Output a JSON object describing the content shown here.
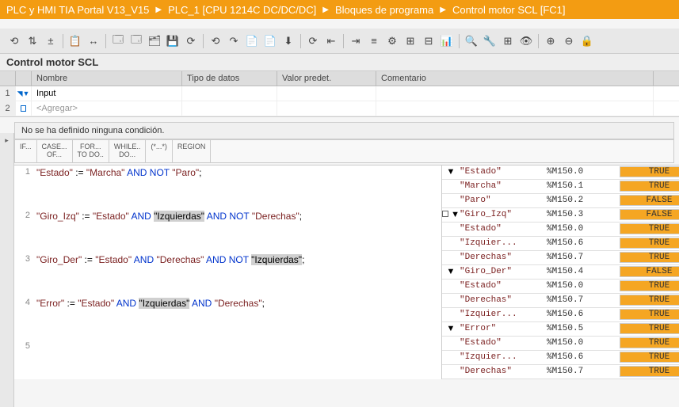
{
  "breadcrumb": {
    "project": "PLC y HMI TIA Portal V13_V15",
    "plc": "PLC_1 [CPU 1214C DC/DC/DC]",
    "folder": "Bloques de programa",
    "block": "Control motor SCL [FC1]"
  },
  "blockTitle": "Control motor SCL",
  "params": {
    "headers": {
      "name": "Nombre",
      "type": "Tipo de datos",
      "default": "Valor predet.",
      "comment": "Comentario"
    },
    "rows": [
      {
        "num": "1",
        "icon": "tri",
        "name": "Input"
      },
      {
        "num": "2",
        "icon": "sq",
        "name": "<Agregar>",
        "add": true
      }
    ]
  },
  "condText": "No se ha definido ninguna condición.",
  "snippets": [
    "IF...",
    "CASE...\nOF...",
    "FOR...\nTO DO..",
    "WHILE..\nDO...",
    "(*...*)",
    "REGION"
  ],
  "code": [
    {
      "n": "1",
      "seg": [
        [
          "str",
          "\"Estado\""
        ],
        [
          "t",
          " := "
        ],
        [
          "str",
          "\"Marcha\""
        ],
        [
          "t",
          " "
        ],
        [
          "kw",
          "AND NOT"
        ],
        [
          "t",
          " "
        ],
        [
          "str",
          "\"Paro\""
        ],
        [
          "t",
          ";"
        ]
      ]
    },
    {
      "blank": true
    },
    {
      "n": "2",
      "seg": [
        [
          "str",
          "\"Giro_Izq\""
        ],
        [
          "t",
          " := "
        ],
        [
          "str",
          "\"Estado\""
        ],
        [
          "t",
          " "
        ],
        [
          "kw",
          "AND"
        ],
        [
          "t",
          " "
        ],
        [
          "hl",
          "\"Izquierdas\""
        ],
        [
          "t",
          " "
        ],
        [
          "kw",
          "AND NOT"
        ],
        [
          "t",
          " "
        ],
        [
          "str",
          "\"Derechas\""
        ],
        [
          "t",
          ";"
        ]
      ]
    },
    {
      "blank": true
    },
    {
      "n": "3",
      "seg": [
        [
          "str",
          "\"Giro_Der\""
        ],
        [
          "t",
          " := "
        ],
        [
          "str",
          "\"Estado\""
        ],
        [
          "t",
          " "
        ],
        [
          "kw",
          "AND"
        ],
        [
          "t",
          " "
        ],
        [
          "str",
          "\"Derechas\""
        ],
        [
          "t",
          " "
        ],
        [
          "kw",
          "AND NOT"
        ],
        [
          "t",
          " "
        ],
        [
          "hl",
          "\"Izquierdas\""
        ],
        [
          "t",
          ";"
        ]
      ]
    },
    {
      "blank": true
    },
    {
      "n": "4",
      "seg": [
        [
          "str",
          "\"Error\""
        ],
        [
          "t",
          " := "
        ],
        [
          "str",
          "\"Estado\""
        ],
        [
          "t",
          " "
        ],
        [
          "kw",
          "AND"
        ],
        [
          "t",
          " "
        ],
        [
          "hl",
          "\"Izquierdas\""
        ],
        [
          "t",
          " "
        ],
        [
          "kw",
          "AND"
        ],
        [
          "t",
          " "
        ],
        [
          "str",
          "\"Derechas\""
        ],
        [
          "t",
          ";"
        ]
      ]
    },
    {
      "blank": true
    },
    {
      "n": "5",
      "seg": []
    }
  ],
  "watch": [
    {
      "g": 1,
      "arr": "▼",
      "nm": "\"Estado\"",
      "ad": "%M150.0",
      "vl": "TRUE"
    },
    {
      "g": 1,
      "nm": "\"Marcha\"",
      "ad": "%M150.1",
      "vl": "TRUE"
    },
    {
      "g": 1,
      "nm": "\"Paro\"",
      "ad": "%M150.2",
      "vl": "FALSE"
    },
    {
      "g": 2,
      "arr": "▼",
      "sq": true,
      "nm": "\"Giro_Izq\"",
      "ad": "%M150.3",
      "vl": "FALSE"
    },
    {
      "g": 2,
      "nm": "\"Estado\"",
      "ad": "%M150.0",
      "vl": "TRUE"
    },
    {
      "g": 2,
      "nm": "\"Izquier...",
      "ad": "%M150.6",
      "vl": "TRUE"
    },
    {
      "g": 2,
      "nm": "\"Derechas\"",
      "ad": "%M150.7",
      "vl": "TRUE"
    },
    {
      "g": 3,
      "arr": "▼",
      "nm": "\"Giro_Der\"",
      "ad": "%M150.4",
      "vl": "FALSE"
    },
    {
      "g": 3,
      "nm": "\"Estado\"",
      "ad": "%M150.0",
      "vl": "TRUE"
    },
    {
      "g": 3,
      "nm": "\"Derechas\"",
      "ad": "%M150.7",
      "vl": "TRUE"
    },
    {
      "g": 3,
      "nm": "\"Izquier...",
      "ad": "%M150.6",
      "vl": "TRUE"
    },
    {
      "g": 4,
      "arr": "▼",
      "nm": "\"Error\"",
      "ad": "%M150.5",
      "vl": "TRUE"
    },
    {
      "g": 4,
      "nm": "\"Estado\"",
      "ad": "%M150.0",
      "vl": "TRUE"
    },
    {
      "g": 4,
      "nm": "\"Izquier...",
      "ad": "%M150.6",
      "vl": "TRUE"
    },
    {
      "g": 4,
      "nm": "\"Derechas\"",
      "ad": "%M150.7",
      "vl": "TRUE"
    }
  ],
  "toolbarIcons": [
    "⟲",
    "⇅",
    "±",
    "📋",
    "↔",
    "🗔",
    "🗔",
    "🗂",
    "💾",
    "⟳",
    "⟲",
    "↷",
    "📄",
    "📄",
    "⬇",
    "⟳",
    "⇤",
    "⇥",
    "≡",
    "⚙",
    "⊞",
    "⊟",
    "📊",
    "🔍",
    "🔧",
    "⊞",
    "👁",
    "⊕",
    "⊖",
    "🔒"
  ]
}
